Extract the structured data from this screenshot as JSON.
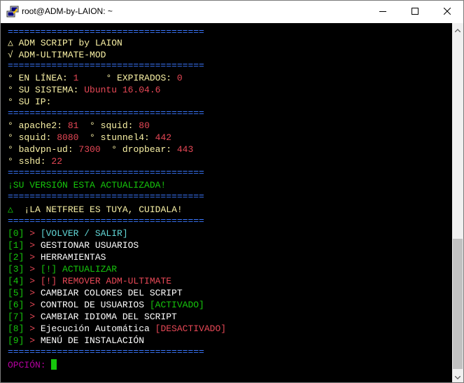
{
  "window": {
    "title": "root@ADM-by-LAION: ~"
  },
  "terminal": {
    "separator": "====================================",
    "header": {
      "line1": "△ ADM SCRIPT by LAION",
      "line2": "√ ADM-ULTIMATE-MOD"
    },
    "status": {
      "online_label": "° EN LÍNEA: ",
      "online_value": "1",
      "expired_label": "     ° EXPIRADOS: ",
      "expired_value": "0",
      "system_label": "° SU SISTEMA: ",
      "system_value": "Ubuntu 16.04.6",
      "ip_label": "° SU IP:"
    },
    "ports": {
      "apache_label": "° apache2: ",
      "apache_value": "81",
      "squid1_label": "  ° squid: ",
      "squid1_value": "80",
      "squid2_label": "° squid: ",
      "squid2_value": "8080",
      "stunnel_label": "  ° stunnel4: ",
      "stunnel_value": "442",
      "badvpn_label": "° badvpn-ud: ",
      "badvpn_value": "7300",
      "dropbear_label": "  ° dropbear: ",
      "dropbear_value": "443",
      "sshd_label": "° sshd: ",
      "sshd_value": "22"
    },
    "version_message": "¡SU VERSIÓN ESTA ACTUALIZADA!",
    "netfree_icon": "△",
    "netfree_message": "  ¡LA NETFREE ES TUYA, CUIDALA!",
    "menu": [
      {
        "num": "[0]",
        "arrow": " > ",
        "text": "[VOLVER / SALIR]",
        "extra": ""
      },
      {
        "num": "[1]",
        "arrow": " > ",
        "text": "GESTIONAR USUARIOS",
        "extra": ""
      },
      {
        "num": "[2]",
        "arrow": " > ",
        "text": "HERRAMIENTAS",
        "extra": ""
      },
      {
        "num": "[3]",
        "arrow": " > ",
        "text": "[!] ACTUALIZAR",
        "extra": ""
      },
      {
        "num": "[4]",
        "arrow": " > ",
        "text": "[!] REMOVER ADM-ULTIMATE",
        "extra": ""
      },
      {
        "num": "[5]",
        "arrow": " > ",
        "text": "CAMBIAR COLORES DEL SCRIPT",
        "extra": ""
      },
      {
        "num": "[6]",
        "arrow": " > ",
        "text": "CONTROL DE USUARIOS ",
        "extra": "[ACTIVADO]"
      },
      {
        "num": "[7]",
        "arrow": " > ",
        "text": "CAMBIAR IDIOMA DEL SCRIPT",
        "extra": ""
      },
      {
        "num": "[8]",
        "arrow": " > ",
        "text": "Ejecución Automática ",
        "extra": "[DESACTIVADO]"
      },
      {
        "num": "[9]",
        "arrow": " > ",
        "text": "MENÚ DE INSTALACIÓN",
        "extra": ""
      }
    ],
    "prompt": "OPCIÓN: "
  },
  "colors": {
    "separator": "#3b78ff",
    "header": "#f9f1a5",
    "value": "#e74856",
    "ok": "#16c60c",
    "menu_back": "#61d6d6",
    "prompt": "#b4009e"
  },
  "icons": {
    "app": "putty-icon",
    "minimize": "minimize-icon",
    "maximize": "maximize-icon",
    "close": "close-icon"
  }
}
